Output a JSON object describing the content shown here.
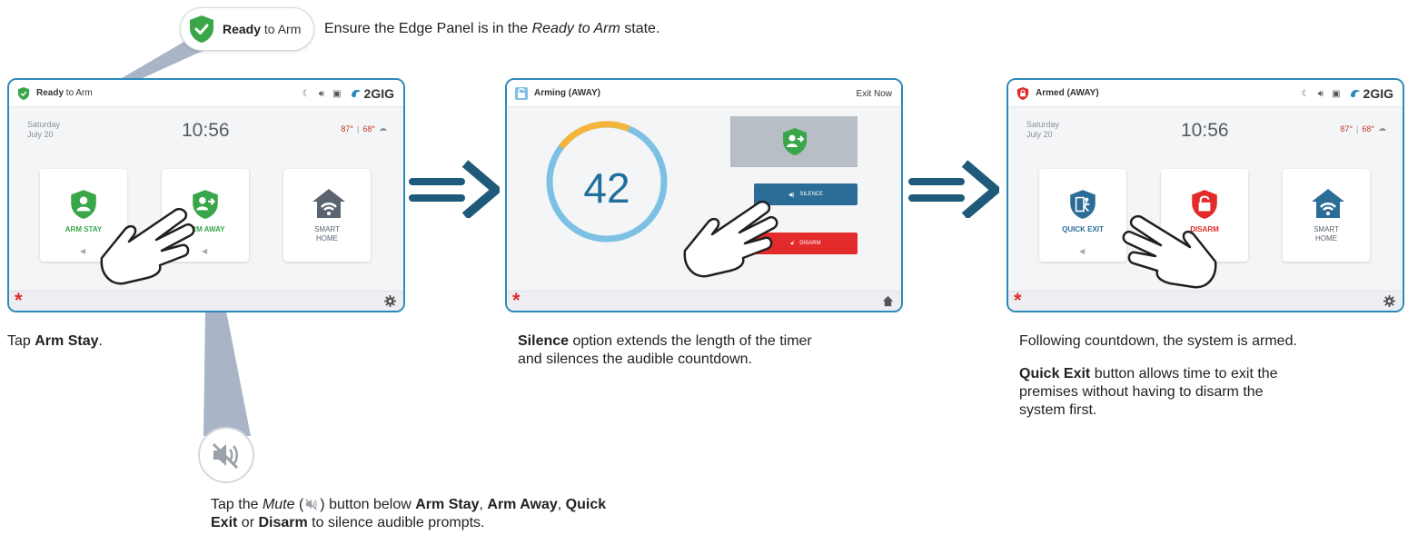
{
  "callout": {
    "ready_bold": "Ready",
    "ready_rest": " to Arm",
    "intro_before": "Ensure the Edge Panel is in the ",
    "intro_italic": "Ready to Arm",
    "intro_after": " state."
  },
  "panel1": {
    "status_bold": "Ready",
    "status_rest": " to Arm",
    "brand": "2GIG",
    "date_day": "Saturday",
    "date_date": "July 20",
    "time": "10:56",
    "temp_high": "87°",
    "temp_low": "68°",
    "cards": [
      {
        "label": "ARM STAY",
        "color": "#3aa64a",
        "icon": "shield-person-icon"
      },
      {
        "label": "ARM AWAY",
        "color": "#3aa64a",
        "icon": "shield-person-arrow-icon"
      },
      {
        "label_line1": "SMART",
        "label_line2": "HOME",
        "color": "#5a6470",
        "icon": "smart-home-icon"
      }
    ]
  },
  "panel2": {
    "status": "Arming (AWAY)",
    "exit_now": "Exit Now",
    "countdown": "42",
    "silence_label": "SILENCE",
    "disarm_label": "DISARM"
  },
  "panel3": {
    "status": "Armed (AWAY)",
    "brand": "2GIG",
    "date_day": "Saturday",
    "date_date": "July 20",
    "time": "10:56",
    "temp_high": "87°",
    "temp_low": "68°",
    "cards": [
      {
        "label": "QUICK EXIT",
        "color": "#2b6d97",
        "icon": "quick-exit-icon"
      },
      {
        "label": "DISARM",
        "color": "#e42b2b",
        "icon": "disarm-lock-icon"
      },
      {
        "label_line1": "SMART",
        "label_line2": "HOME",
        "color": "#2b6d97",
        "icon": "smart-home-icon"
      }
    ]
  },
  "captions": {
    "c1_before": "Tap ",
    "c1_bold": "Arm Stay",
    "c1_after": ".",
    "c2_bold": "Silence",
    "c2_rest": " option extends the length of the timer",
    "c2_line2": "and silences the audible countdown.",
    "c3_line1": "Following countdown, the system is armed.",
    "c3_bold": "Quick Exit",
    "c3_rest": " button allows time to exit the",
    "c3_line3": "premises without having to disarm the",
    "c3_line4": "system first.",
    "mute_before": "Tap the ",
    "mute_italic": "Mute",
    "mute_paren_open": " (",
    "mute_paren_close": ") button below ",
    "mute_b1": "Arm Stay",
    "mute_sep1": ", ",
    "mute_b2": "Arm Away",
    "mute_sep2": ", ",
    "mute_b3": "Quick",
    "mute_b3b": "Exit",
    "mute_or": " or ",
    "mute_b4": "Disarm",
    "mute_after": " to silence audible prompts."
  },
  "colors": {
    "panel_border": "#2d8ab8",
    "arrow": "#1f5a7a",
    "ready_green": "#3aa64a",
    "alarm_red": "#e42b2b",
    "ring_blue": "#7cc0e3",
    "ring_yellow": "#f5b53a"
  }
}
